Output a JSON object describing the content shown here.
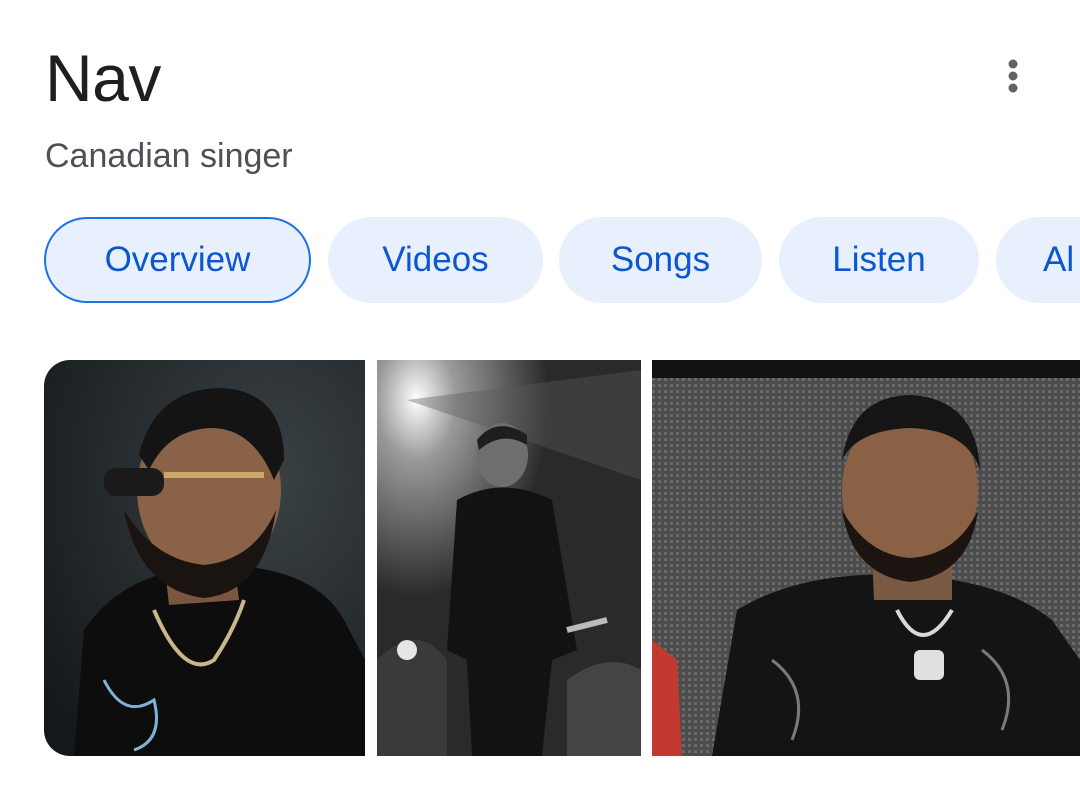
{
  "header": {
    "title": "Nav",
    "subtitle": "Canadian singer",
    "more_icon": "more-vert-icon"
  },
  "tabs": [
    {
      "label": "Overview",
      "selected": true
    },
    {
      "label": "Videos",
      "selected": false
    },
    {
      "label": "Songs",
      "selected": false
    },
    {
      "label": "Listen",
      "selected": false
    },
    {
      "label": "Al",
      "selected": false
    }
  ],
  "colors": {
    "chip_bg": "#e8f0fe",
    "chip_text": "#0b57d0",
    "chip_selected_border": "#1a73e8",
    "title": "#1f1f1f",
    "subtitle": "#4d5156"
  },
  "images": [
    {
      "description": "portrait-photo"
    },
    {
      "description": "stage-performance-photo"
    },
    {
      "description": "event-photo"
    }
  ]
}
